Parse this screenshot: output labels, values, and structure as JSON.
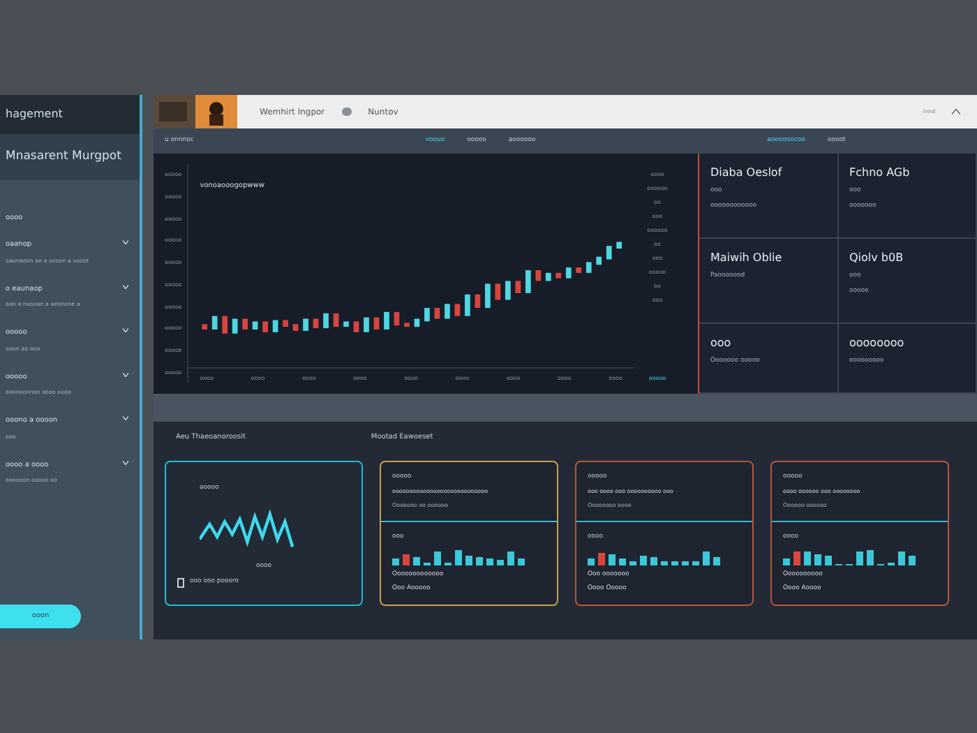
{
  "sidebar": {
    "title": "hagement",
    "subtitle": "Mnasarent Murgpot",
    "section": "oooo",
    "items": [
      {
        "label": "oaanop",
        "detail": "oaonaeon ae a oooon a oooot"
      },
      {
        "label": "o eaunaop",
        "detail": "oon a noooan a aeonone a"
      },
      {
        "label": "ooooo",
        "detail": "ooon ao ooo"
      },
      {
        "label": "ooooo",
        "detail": "ooonoonnon oooo oooo"
      },
      {
        "label": "ooono a oooon",
        "detail": "ooo"
      },
      {
        "label": "oooo a oooo",
        "detail": "oooooon ooooo oo"
      }
    ],
    "button": "ooon"
  },
  "header": {
    "title": "Wemhirt Ingpor",
    "link": "Nuntov",
    "right": "lnnd"
  },
  "toolbar": [
    {
      "label": "u onnnoc",
      "selected": false
    },
    {
      "label": "voouo",
      "selected": true
    },
    {
      "label": "ooooo",
      "selected": false
    },
    {
      "label": "aoooooo",
      "selected": false
    },
    {
      "label": "aoooooocoo",
      "selected": true
    },
    {
      "label": "oooot",
      "selected": false
    }
  ],
  "chart_panel": {
    "title": "vonoaooogopwww",
    "y_labels": [
      "ooooo",
      "ooooo",
      "ooooo",
      "ooooo",
      "ooooo",
      "ooooo",
      "ooooo",
      "ooooo",
      "ooooo",
      "ooooo"
    ],
    "x_labels": [
      "oooo",
      "oooo",
      "oooo",
      "oooo",
      "oooo",
      "oooo",
      "oooo",
      "oooo",
      "oooo"
    ],
    "legend": [
      "oooo",
      "oooooo",
      "oo",
      "ooo",
      "oooooo",
      "oo",
      "ooo",
      "ooooo",
      "oo",
      "ooo"
    ],
    "footer": "ooooo"
  },
  "stats": [
    {
      "title": "Diaba Oeslof",
      "lines": [
        "ooo",
        "oooooooooooo"
      ]
    },
    {
      "title": "Fchno AGb",
      "lines": [
        "ooo",
        "ooooooo"
      ]
    },
    {
      "title": "Maiwih Oblie",
      "lines": [
        "Paooooood"
      ]
    },
    {
      "title": "Qiolv b0B",
      "lines": [
        "ooo",
        "ooooo"
      ]
    },
    {
      "title": "ooo",
      "lines": [
        "Ooooooo ooooo"
      ]
    },
    {
      "title": "oooooooo",
      "lines": [
        "ooooooooo"
      ]
    }
  ],
  "bottom": {
    "titles": [
      "Aeu Thaeoanoroosit",
      "Mootad Eawoeset"
    ],
    "cards": [
      {
        "kind": "wave",
        "label": "aoooo",
        "value": "oooo",
        "footer": "ooo ooo poooro",
        "color": "#22b8d8"
      },
      {
        "kind": "bars",
        "label": "ooooo",
        "line1": "oooooooooooooooooooooooooooo",
        "line2": "Ooooooo oo oooooo",
        "label2": "ooo",
        "foot1": "Ooooooooooooo",
        "foot2": "Ooo Aooooo",
        "color": "#c9a24a"
      },
      {
        "kind": "bars",
        "label": "ooooo",
        "line1": "ooo oooo ooo oooooooooo ooo",
        "line2": "Oooooooo oooo",
        "label2": "oooo",
        "foot1": "Ooo ooooooo",
        "foot2": "Oooo Ooooo",
        "color": "#b5573c"
      },
      {
        "kind": "bars",
        "label": "ooooo",
        "line1": "oooo oooooo ooo oooooooo",
        "line2": "Oooooo oooooo",
        "label2": "oooo",
        "foot1": "Oooooooooo",
        "foot2": "Oooo Aoooo",
        "color": "#b5573c"
      }
    ]
  }
}
